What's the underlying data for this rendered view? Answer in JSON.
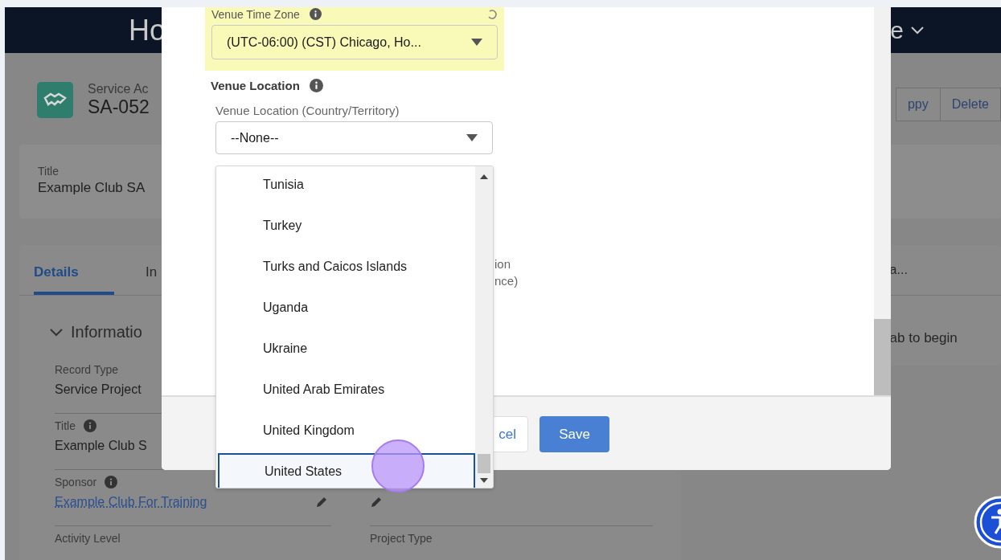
{
  "header": {
    "left_text": "Ho",
    "right_text": "e"
  },
  "record": {
    "object_label": "Service Ac",
    "record_id": "SA-052",
    "actions": [
      "ppy",
      "Delete"
    ]
  },
  "title_card": {
    "label": "Title",
    "value": "Example Club SA"
  },
  "tabs": [
    {
      "label": "Details",
      "selected": true
    },
    {
      "label": "In",
      "selected": false
    }
  ],
  "side_tab_text": "a...",
  "side_panel_text": "ab to begin",
  "section": {
    "title": "Informatio",
    "expanded": true
  },
  "fields": [
    {
      "label": "Record Type",
      "value": "Service Project",
      "info": false,
      "link": false,
      "editable": false
    },
    {
      "label": "Title",
      "value": "Example Club S",
      "info": true,
      "link": false,
      "editable": false
    },
    {
      "label": "Sponsor",
      "value": "Example Club For Training",
      "info": true,
      "link": true,
      "editable": true
    },
    {
      "label": "Activity Level",
      "info": false,
      "link": false,
      "editable": false
    }
  ],
  "right_fields": [
    {
      "editable": true
    },
    {
      "label": "Project Type",
      "editable": false
    }
  ],
  "modal": {
    "time_zone": {
      "label": "Venue Time Zone",
      "value": "(UTC-06:00) (CST) Chicago, Ho...",
      "highlighted": true
    },
    "location": {
      "heading": "Venue Location",
      "country_label": "Venue Location (Country/Territory)",
      "country_value": "--None--"
    },
    "partial_labels": [
      "ion",
      "nce)"
    ],
    "buttons": [
      {
        "label": "cel",
        "kind": "neutral"
      },
      {
        "label": "Save",
        "kind": "brand"
      }
    ]
  },
  "dropdown": {
    "options": [
      {
        "label": "Tunisia",
        "selected": false
      },
      {
        "label": "Turkey",
        "selected": false
      },
      {
        "label": "Turks and Caicos Islands",
        "selected": false
      },
      {
        "label": "Uganda",
        "selected": false
      },
      {
        "label": "Ukraine",
        "selected": false
      },
      {
        "label": "United Arab Emirates",
        "selected": false
      },
      {
        "label": "United Kingdom",
        "selected": false
      },
      {
        "label": "United States",
        "selected": true
      }
    ]
  }
}
